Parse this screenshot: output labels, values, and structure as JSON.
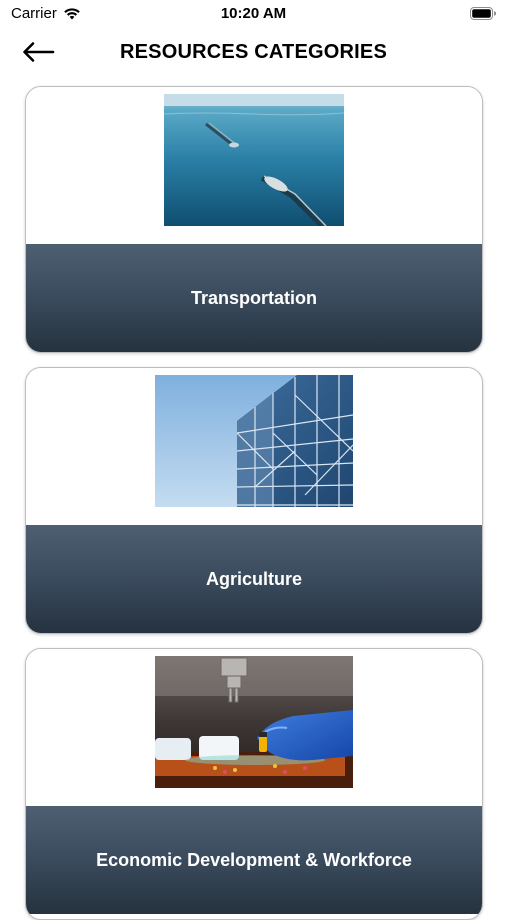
{
  "status_bar": {
    "carrier": "Carrier",
    "time": "10:20 AM"
  },
  "header": {
    "title": "RESOURCES CATEGORIES",
    "back_icon": "back-arrow-icon"
  },
  "categories": [
    {
      "label": "Transportation",
      "image": "aerial-bridge-water-photo"
    },
    {
      "label": "Agriculture",
      "image": "glass-steel-building-photo"
    },
    {
      "label": "Economic Development & Workforce",
      "image": "laboratory-gloved-hand-photo"
    }
  ],
  "colors": {
    "card_footer_top": "#4d5f71",
    "card_footer_bottom": "#25323f",
    "card_label": "#ffffff",
    "card_border": "#bdbdbd"
  }
}
